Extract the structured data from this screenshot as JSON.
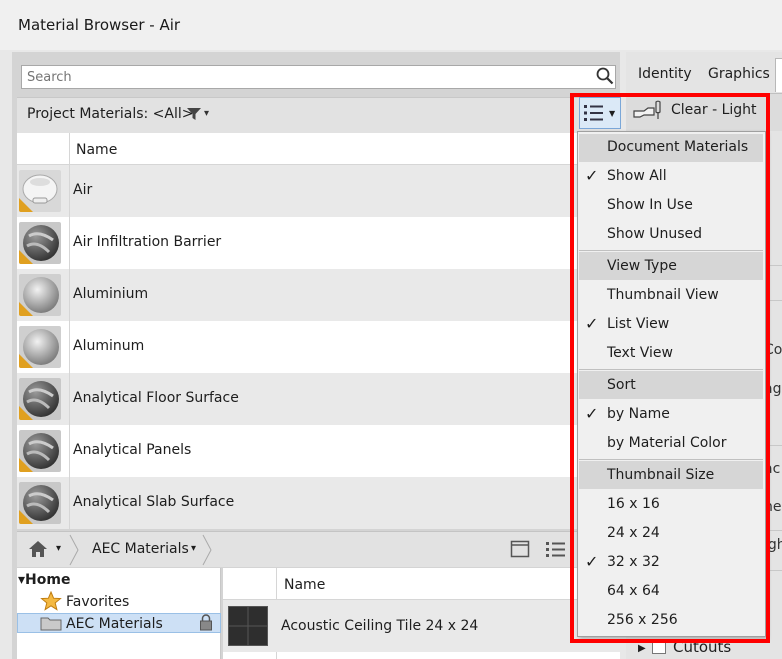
{
  "window": {
    "title": "Material Browser - Air"
  },
  "search": {
    "placeholder": "Search"
  },
  "project": {
    "label": "Project Materials: <All>"
  },
  "list": {
    "column_name": "Name",
    "items": [
      {
        "name": "Air",
        "thumb": "air"
      },
      {
        "name": "Air Infiltration Barrier",
        "thumb": "dark"
      },
      {
        "name": "Aluminium",
        "thumb": "metal"
      },
      {
        "name": "Aluminum",
        "thumb": "metal"
      },
      {
        "name": "Analytical Floor Surface",
        "thumb": "dark"
      },
      {
        "name": "Analytical Panels",
        "thumb": "dark"
      },
      {
        "name": "Analytical Slab Surface",
        "thumb": "dark"
      }
    ]
  },
  "library": {
    "breadcrumb": "AEC Materials",
    "tree": {
      "home": "Home",
      "favorites": "Favorites",
      "aec": "AEC Materials"
    },
    "column_name": "Name",
    "item": "Acoustic Ceiling Tile 24 x 24"
  },
  "right": {
    "tab_identity": "Identity",
    "tab_graphics": "Graphics",
    "asset_label": "Clear - Light",
    "cutouts": "Cutouts",
    "fragments": [
      "Col",
      "ag",
      "ac",
      "ne",
      "igh"
    ]
  },
  "menu": {
    "group_document": "Document Materials",
    "show_all": "Show All",
    "show_in_use": "Show In Use",
    "show_unused": "Show Unused",
    "group_view": "View Type",
    "thumbnail_view": "Thumbnail View",
    "list_view": "List View",
    "text_view": "Text View",
    "group_sort": "Sort",
    "by_name": "by Name",
    "by_color": "by Material Color",
    "group_size": "Thumbnail Size",
    "size_16": "16 x 16",
    "size_24": "24 x 24",
    "size_32": "32 x 32",
    "size_64": "64 x 64",
    "size_256": "256 x 256",
    "check_glyph": "✓"
  },
  "colors": {
    "highlight": "#ff0000",
    "selection": "#cde0f5",
    "warning": "#e0a020"
  }
}
